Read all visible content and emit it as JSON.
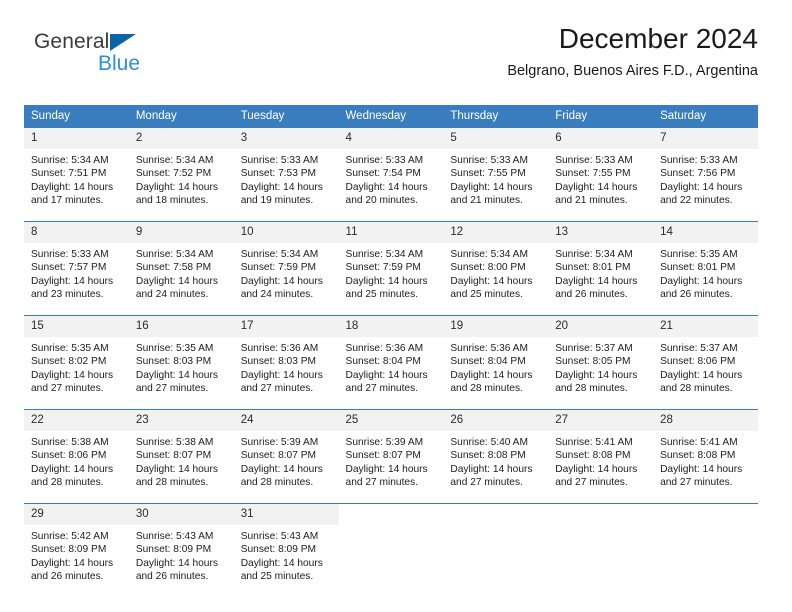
{
  "logo": {
    "word_one": "General",
    "word_two": "Blue",
    "triangle_color": "#0b63a8",
    "blue_color": "#2f8fd4"
  },
  "header": {
    "title": "December 2024",
    "location": "Belgrano, Buenos Aires F.D., Argentina"
  },
  "theme": {
    "header_bg": "#3a7dbf",
    "daynum_bg": "#f2f2f2"
  },
  "weekday_headers": [
    "Sunday",
    "Monday",
    "Tuesday",
    "Wednesday",
    "Thursday",
    "Friday",
    "Saturday"
  ],
  "weeks": [
    [
      {
        "day": "1",
        "sunrise": "Sunrise: 5:34 AM",
        "sunset": "Sunset: 7:51 PM",
        "daylight1": "Daylight: 14 hours",
        "daylight2": "and 17 minutes."
      },
      {
        "day": "2",
        "sunrise": "Sunrise: 5:34 AM",
        "sunset": "Sunset: 7:52 PM",
        "daylight1": "Daylight: 14 hours",
        "daylight2": "and 18 minutes."
      },
      {
        "day": "3",
        "sunrise": "Sunrise: 5:33 AM",
        "sunset": "Sunset: 7:53 PM",
        "daylight1": "Daylight: 14 hours",
        "daylight2": "and 19 minutes."
      },
      {
        "day": "4",
        "sunrise": "Sunrise: 5:33 AM",
        "sunset": "Sunset: 7:54 PM",
        "daylight1": "Daylight: 14 hours",
        "daylight2": "and 20 minutes."
      },
      {
        "day": "5",
        "sunrise": "Sunrise: 5:33 AM",
        "sunset": "Sunset: 7:55 PM",
        "daylight1": "Daylight: 14 hours",
        "daylight2": "and 21 minutes."
      },
      {
        "day": "6",
        "sunrise": "Sunrise: 5:33 AM",
        "sunset": "Sunset: 7:55 PM",
        "daylight1": "Daylight: 14 hours",
        "daylight2": "and 21 minutes."
      },
      {
        "day": "7",
        "sunrise": "Sunrise: 5:33 AM",
        "sunset": "Sunset: 7:56 PM",
        "daylight1": "Daylight: 14 hours",
        "daylight2": "and 22 minutes."
      }
    ],
    [
      {
        "day": "8",
        "sunrise": "Sunrise: 5:33 AM",
        "sunset": "Sunset: 7:57 PM",
        "daylight1": "Daylight: 14 hours",
        "daylight2": "and 23 minutes."
      },
      {
        "day": "9",
        "sunrise": "Sunrise: 5:34 AM",
        "sunset": "Sunset: 7:58 PM",
        "daylight1": "Daylight: 14 hours",
        "daylight2": "and 24 minutes."
      },
      {
        "day": "10",
        "sunrise": "Sunrise: 5:34 AM",
        "sunset": "Sunset: 7:59 PM",
        "daylight1": "Daylight: 14 hours",
        "daylight2": "and 24 minutes."
      },
      {
        "day": "11",
        "sunrise": "Sunrise: 5:34 AM",
        "sunset": "Sunset: 7:59 PM",
        "daylight1": "Daylight: 14 hours",
        "daylight2": "and 25 minutes."
      },
      {
        "day": "12",
        "sunrise": "Sunrise: 5:34 AM",
        "sunset": "Sunset: 8:00 PM",
        "daylight1": "Daylight: 14 hours",
        "daylight2": "and 25 minutes."
      },
      {
        "day": "13",
        "sunrise": "Sunrise: 5:34 AM",
        "sunset": "Sunset: 8:01 PM",
        "daylight1": "Daylight: 14 hours",
        "daylight2": "and 26 minutes."
      },
      {
        "day": "14",
        "sunrise": "Sunrise: 5:35 AM",
        "sunset": "Sunset: 8:01 PM",
        "daylight1": "Daylight: 14 hours",
        "daylight2": "and 26 minutes."
      }
    ],
    [
      {
        "day": "15",
        "sunrise": "Sunrise: 5:35 AM",
        "sunset": "Sunset: 8:02 PM",
        "daylight1": "Daylight: 14 hours",
        "daylight2": "and 27 minutes."
      },
      {
        "day": "16",
        "sunrise": "Sunrise: 5:35 AM",
        "sunset": "Sunset: 8:03 PM",
        "daylight1": "Daylight: 14 hours",
        "daylight2": "and 27 minutes."
      },
      {
        "day": "17",
        "sunrise": "Sunrise: 5:36 AM",
        "sunset": "Sunset: 8:03 PM",
        "daylight1": "Daylight: 14 hours",
        "daylight2": "and 27 minutes."
      },
      {
        "day": "18",
        "sunrise": "Sunrise: 5:36 AM",
        "sunset": "Sunset: 8:04 PM",
        "daylight1": "Daylight: 14 hours",
        "daylight2": "and 27 minutes."
      },
      {
        "day": "19",
        "sunrise": "Sunrise: 5:36 AM",
        "sunset": "Sunset: 8:04 PM",
        "daylight1": "Daylight: 14 hours",
        "daylight2": "and 28 minutes."
      },
      {
        "day": "20",
        "sunrise": "Sunrise: 5:37 AM",
        "sunset": "Sunset: 8:05 PM",
        "daylight1": "Daylight: 14 hours",
        "daylight2": "and 28 minutes."
      },
      {
        "day": "21",
        "sunrise": "Sunrise: 5:37 AM",
        "sunset": "Sunset: 8:06 PM",
        "daylight1": "Daylight: 14 hours",
        "daylight2": "and 28 minutes."
      }
    ],
    [
      {
        "day": "22",
        "sunrise": "Sunrise: 5:38 AM",
        "sunset": "Sunset: 8:06 PM",
        "daylight1": "Daylight: 14 hours",
        "daylight2": "and 28 minutes."
      },
      {
        "day": "23",
        "sunrise": "Sunrise: 5:38 AM",
        "sunset": "Sunset: 8:07 PM",
        "daylight1": "Daylight: 14 hours",
        "daylight2": "and 28 minutes."
      },
      {
        "day": "24",
        "sunrise": "Sunrise: 5:39 AM",
        "sunset": "Sunset: 8:07 PM",
        "daylight1": "Daylight: 14 hours",
        "daylight2": "and 28 minutes."
      },
      {
        "day": "25",
        "sunrise": "Sunrise: 5:39 AM",
        "sunset": "Sunset: 8:07 PM",
        "daylight1": "Daylight: 14 hours",
        "daylight2": "and 27 minutes."
      },
      {
        "day": "26",
        "sunrise": "Sunrise: 5:40 AM",
        "sunset": "Sunset: 8:08 PM",
        "daylight1": "Daylight: 14 hours",
        "daylight2": "and 27 minutes."
      },
      {
        "day": "27",
        "sunrise": "Sunrise: 5:41 AM",
        "sunset": "Sunset: 8:08 PM",
        "daylight1": "Daylight: 14 hours",
        "daylight2": "and 27 minutes."
      },
      {
        "day": "28",
        "sunrise": "Sunrise: 5:41 AM",
        "sunset": "Sunset: 8:08 PM",
        "daylight1": "Daylight: 14 hours",
        "daylight2": "and 27 minutes."
      }
    ],
    [
      {
        "day": "29",
        "sunrise": "Sunrise: 5:42 AM",
        "sunset": "Sunset: 8:09 PM",
        "daylight1": "Daylight: 14 hours",
        "daylight2": "and 26 minutes."
      },
      {
        "day": "30",
        "sunrise": "Sunrise: 5:43 AM",
        "sunset": "Sunset: 8:09 PM",
        "daylight1": "Daylight: 14 hours",
        "daylight2": "and 26 minutes."
      },
      {
        "day": "31",
        "sunrise": "Sunrise: 5:43 AM",
        "sunset": "Sunset: 8:09 PM",
        "daylight1": "Daylight: 14 hours",
        "daylight2": "and 25 minutes."
      },
      {
        "day": "",
        "sunrise": "",
        "sunset": "",
        "daylight1": "",
        "daylight2": ""
      },
      {
        "day": "",
        "sunrise": "",
        "sunset": "",
        "daylight1": "",
        "daylight2": ""
      },
      {
        "day": "",
        "sunrise": "",
        "sunset": "",
        "daylight1": "",
        "daylight2": ""
      },
      {
        "day": "",
        "sunrise": "",
        "sunset": "",
        "daylight1": "",
        "daylight2": ""
      }
    ]
  ]
}
